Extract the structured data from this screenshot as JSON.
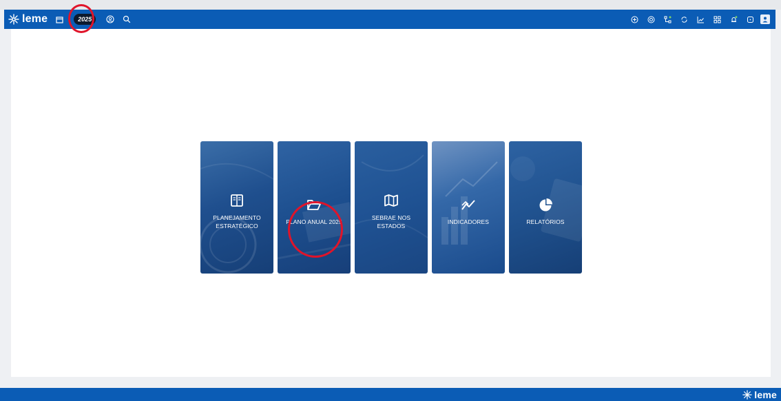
{
  "app": {
    "logo_text": "leme",
    "year_badge": "2025"
  },
  "header": {
    "left_icons": [
      "calendar-icon",
      "user-circle-icon",
      "search-icon"
    ],
    "right_icons": [
      "plus-circle-icon",
      "target-icon",
      "hierarchy-icon",
      "refresh-icon",
      "line-chart-icon",
      "grid-icon",
      "bell-icon",
      "help-icon",
      "avatar-icon"
    ]
  },
  "cards": [
    {
      "label": "PLANEJAMENTO ESTRATÉGICO",
      "icon": "book-icon"
    },
    {
      "label": "PLANO ANUAL 2025",
      "icon": "folder-open-icon"
    },
    {
      "label": "SEBRAE NOS ESTADOS",
      "icon": "map-icon"
    },
    {
      "label": "INDICADORES",
      "icon": "trend-icon"
    },
    {
      "label": "RELATÓRIOS",
      "icon": "pie-chart-icon"
    }
  ],
  "footer": {
    "logo_text": "leme"
  },
  "colors": {
    "brand": "#0b5cb5",
    "annotation": "#e0142a",
    "card": "#1f4f8e"
  }
}
